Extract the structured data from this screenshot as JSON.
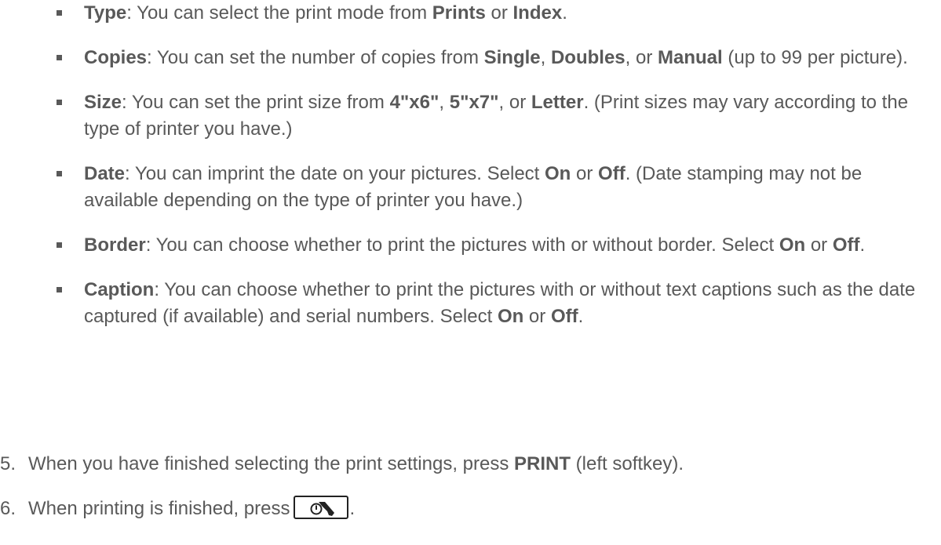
{
  "bullets": [
    {
      "term": "Type",
      "segments": [
        {
          "text": ": You can select the print mode from ",
          "bold": false
        },
        {
          "text": "Prints",
          "bold": true
        },
        {
          "text": " or ",
          "bold": false
        },
        {
          "text": "Index",
          "bold": true
        },
        {
          "text": ".",
          "bold": false
        }
      ]
    },
    {
      "term": "Copies",
      "segments": [
        {
          "text": ": You can set the number of copies from ",
          "bold": false
        },
        {
          "text": "Single",
          "bold": true
        },
        {
          "text": ", ",
          "bold": false
        },
        {
          "text": "Doubles",
          "bold": true
        },
        {
          "text": ", or ",
          "bold": false
        },
        {
          "text": "Manual",
          "bold": true
        },
        {
          "text": " (up to 99 per picture).",
          "bold": false
        }
      ]
    },
    {
      "term": "Size",
      "segments": [
        {
          "text": ": You can set the print size from ",
          "bold": false
        },
        {
          "text": "4\"x6\"",
          "bold": true
        },
        {
          "text": ", ",
          "bold": false
        },
        {
          "text": "5\"x7\"",
          "bold": true
        },
        {
          "text": ", or ",
          "bold": false
        },
        {
          "text": "Letter",
          "bold": true
        },
        {
          "text": ". (Print sizes may vary according to the type of printer you have.)",
          "bold": false
        }
      ]
    },
    {
      "term": "Date",
      "segments": [
        {
          "text": ": You can imprint the date on your pictures. Select ",
          "bold": false
        },
        {
          "text": "On",
          "bold": true
        },
        {
          "text": " or ",
          "bold": false
        },
        {
          "text": "Off",
          "bold": true
        },
        {
          "text": ". (Date stamping may not be available depending on the type of printer you have.)",
          "bold": false
        }
      ]
    },
    {
      "term": "Border",
      "segments": [
        {
          "text": ": You can choose whether to print the pictures with or without border. Select ",
          "bold": false
        },
        {
          "text": "On",
          "bold": true
        },
        {
          "text": " or ",
          "bold": false
        },
        {
          "text": "Off",
          "bold": true
        },
        {
          "text": ".",
          "bold": false
        }
      ]
    },
    {
      "term": "Caption",
      "segments": [
        {
          "text": ": You can choose whether to print the pictures with or without text captions such as the date captured (if available) and serial numbers. Select ",
          "bold": false
        },
        {
          "text": "On",
          "bold": true
        },
        {
          "text": " or ",
          "bold": false
        },
        {
          "text": "Off",
          "bold": true
        },
        {
          "text": ".",
          "bold": false
        }
      ]
    }
  ],
  "steps": [
    {
      "number": "5.",
      "before": "When you have finished selecting the print settings, press ",
      "key_label": "PRINT",
      "after": " (left softkey)."
    },
    {
      "number": "6.",
      "before": "When printing is finished, press",
      "key_icon": "end-call-power-icon",
      "after": "."
    }
  ]
}
